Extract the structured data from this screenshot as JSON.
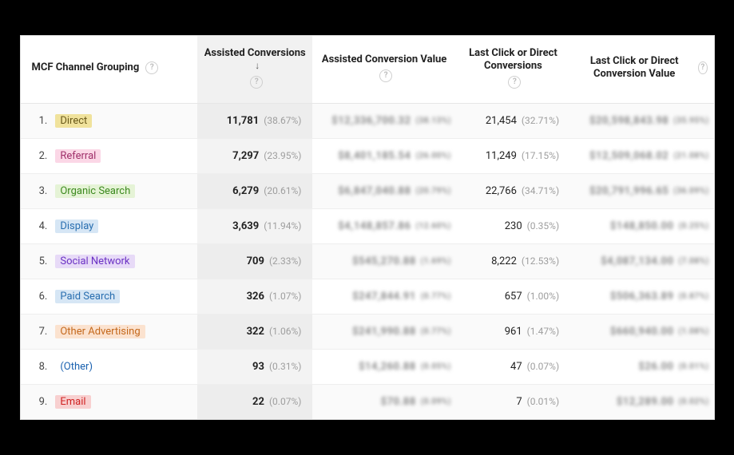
{
  "headers": {
    "channel": "MCF Channel Grouping",
    "assisted": "Assisted Conversions",
    "acv": "Assisted Conversion Value",
    "last": "Last Click or Direct Conversions",
    "lcv": "Last Click or Direct Conversion Value"
  },
  "rows": [
    {
      "rank": "1.",
      "channel": "Direct",
      "c_bg": "#f0e29c",
      "c_fg": "#6a5a1a",
      "assisted": "11,781",
      "assisted_pct": "(38.67%)",
      "last": "21,454",
      "last_pct": "(32.71%)",
      "ob1": "$12,336,700.32",
      "ob1s": "(38.13%)",
      "ob2": "$20,598,843.98",
      "ob2s": "(35.95%)"
    },
    {
      "rank": "2.",
      "channel": "Referral",
      "c_bg": "#fbd7e6",
      "c_fg": "#a0306a",
      "assisted": "7,297",
      "assisted_pct": "(23.95%)",
      "last": "11,249",
      "last_pct": "(17.15%)",
      "ob1": "$8,401,185.54",
      "ob1s": "(26.00%)",
      "ob2": "$12,509,068.02",
      "ob2s": "(21.08%)"
    },
    {
      "rank": "3.",
      "channel": "Organic Search",
      "c_bg": "#e5f3d6",
      "c_fg": "#3c8a1f",
      "assisted": "6,279",
      "assisted_pct": "(20.61%)",
      "last": "22,766",
      "last_pct": "(34.71%)",
      "ob1": "$6,847,040.88",
      "ob1s": "(20.79%)",
      "ob2": "$20,791,996.65",
      "ob2s": "(36.09%)"
    },
    {
      "rank": "4.",
      "channel": "Display",
      "c_bg": "#d6e6f5",
      "c_fg": "#2a6fb0",
      "assisted": "3,639",
      "assisted_pct": "(11.94%)",
      "last": "230",
      "last_pct": "(0.35%)",
      "ob1": "$4,148,857.86",
      "ob1s": "(12.60%)",
      "ob2": "$148,850.00",
      "ob2s": "(0.25%)"
    },
    {
      "rank": "5.",
      "channel": "Social Network",
      "c_bg": "#e7daf7",
      "c_fg": "#6b32c4",
      "assisted": "709",
      "assisted_pct": "(2.33%)",
      "last": "8,222",
      "last_pct": "(12.53%)",
      "ob1": "$545,270.88",
      "ob1s": "(1.69%)",
      "ob2": "$4,087,134.00",
      "ob2s": "(7.08%)"
    },
    {
      "rank": "6.",
      "channel": "Paid Search",
      "c_bg": "#d6e6f5",
      "c_fg": "#2a6fb0",
      "assisted": "326",
      "assisted_pct": "(1.07%)",
      "last": "657",
      "last_pct": "(1.00%)",
      "ob1": "$247,844.91",
      "ob1s": "(0.77%)",
      "ob2": "$506,363.89",
      "ob2s": "(0.87%)"
    },
    {
      "rank": "7.",
      "channel": "Other Advertising",
      "c_bg": "#fbe2cf",
      "c_fg": "#c4691d",
      "assisted": "322",
      "assisted_pct": "(1.06%)",
      "last": "961",
      "last_pct": "(1.47%)",
      "ob1": "$241,990.88",
      "ob1s": "(0.77%)",
      "ob2": "$660,940.00",
      "ob2s": "(1.08%)"
    },
    {
      "rank": "8.",
      "channel": "(Other)",
      "c_bg": "transparent",
      "c_fg": "#1b62b0",
      "assisted": "93",
      "assisted_pct": "(0.31%)",
      "last": "47",
      "last_pct": "(0.07%)",
      "ob1": "$14,260.88",
      "ob1s": "(0.05%)",
      "ob2": "$26.00",
      "ob2s": "(0.01%)"
    },
    {
      "rank": "9.",
      "channel": "Email",
      "c_bg": "#f8d0d0",
      "c_fg": "#d02323",
      "assisted": "22",
      "assisted_pct": "(0.07%)",
      "last": "7",
      "last_pct": "(0.01%)",
      "ob1": "$70.88",
      "ob1s": "(0.09%)",
      "ob2": "$12,289.00",
      "ob2s": "(0.02%)"
    }
  ]
}
